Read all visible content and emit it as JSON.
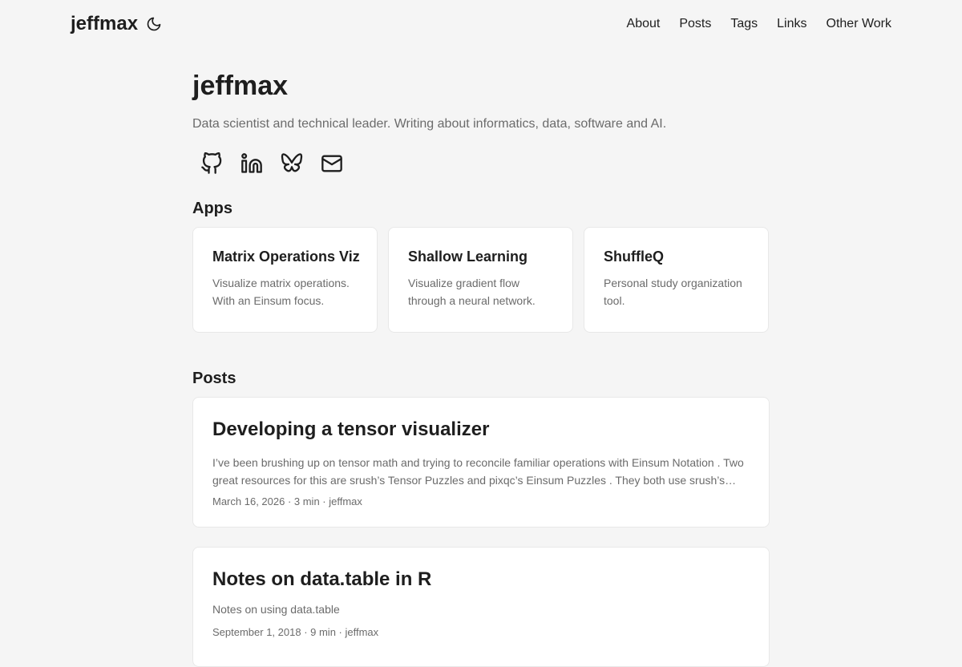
{
  "header": {
    "logo": "jeffmax",
    "theme_icon": "moon-icon",
    "nav": [
      "About",
      "Posts",
      "Tags",
      "Links",
      "Other Work"
    ]
  },
  "profile": {
    "title": "jeffmax",
    "subtitle": "Data scientist and technical leader. Writing about informatics, data, software and AI.",
    "social_icons": [
      "github-icon",
      "linkedin-icon",
      "bluesky-icon",
      "email-icon"
    ]
  },
  "apps": {
    "title": "Apps",
    "items": [
      {
        "title": "Matrix Operations Viz",
        "description": "Visualize matrix operations. With an Einsum focus."
      },
      {
        "title": "Shallow Learning",
        "description": "Visualize gradient flow through a neural network."
      },
      {
        "title": "ShuffleQ",
        "description": "Personal study organization tool."
      }
    ]
  },
  "posts": {
    "title": "Posts",
    "items": [
      {
        "title": "Developing a tensor visualizer",
        "excerpt": "I’ve been brushing up on tensor math and trying to reconcile familiar operations with Einsum Notation . Two great resources for this are srush’s Tensor Puzzles and pixqc’s Einsum Puzzles . They both use srush’s…",
        "meta": "March 16, 2026 · 3 min · jeffmax"
      },
      {
        "title": "Notes on data.table in R",
        "excerpt": "Notes on using data.table",
        "meta": "September 1, 2018 · 9 min · jeffmax"
      }
    ]
  },
  "colors": {
    "background": "#f5f5f5",
    "card": "#ffffff",
    "text": "#1e1e1e",
    "muted": "#6b6b6b",
    "border": "#e8e8e8"
  }
}
